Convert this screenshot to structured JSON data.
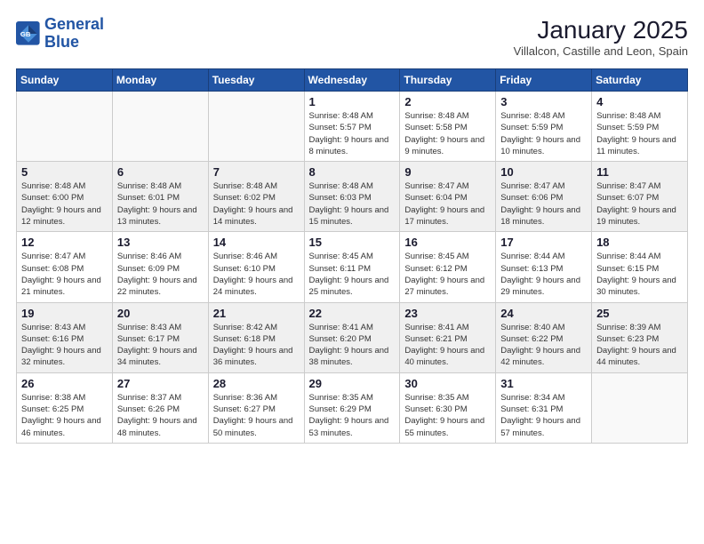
{
  "logo": {
    "line1": "General",
    "line2": "Blue"
  },
  "title": "January 2025",
  "location": "Villalcon, Castille and Leon, Spain",
  "weekdays": [
    "Sunday",
    "Monday",
    "Tuesday",
    "Wednesday",
    "Thursday",
    "Friday",
    "Saturday"
  ],
  "weeks": [
    [
      {
        "day": "",
        "sunrise": "",
        "sunset": "",
        "daylight": ""
      },
      {
        "day": "",
        "sunrise": "",
        "sunset": "",
        "daylight": ""
      },
      {
        "day": "",
        "sunrise": "",
        "sunset": "",
        "daylight": ""
      },
      {
        "day": "1",
        "sunrise": "Sunrise: 8:48 AM",
        "sunset": "Sunset: 5:57 PM",
        "daylight": "Daylight: 9 hours and 8 minutes."
      },
      {
        "day": "2",
        "sunrise": "Sunrise: 8:48 AM",
        "sunset": "Sunset: 5:58 PM",
        "daylight": "Daylight: 9 hours and 9 minutes."
      },
      {
        "day": "3",
        "sunrise": "Sunrise: 8:48 AM",
        "sunset": "Sunset: 5:59 PM",
        "daylight": "Daylight: 9 hours and 10 minutes."
      },
      {
        "day": "4",
        "sunrise": "Sunrise: 8:48 AM",
        "sunset": "Sunset: 5:59 PM",
        "daylight": "Daylight: 9 hours and 11 minutes."
      }
    ],
    [
      {
        "day": "5",
        "sunrise": "Sunrise: 8:48 AM",
        "sunset": "Sunset: 6:00 PM",
        "daylight": "Daylight: 9 hours and 12 minutes."
      },
      {
        "day": "6",
        "sunrise": "Sunrise: 8:48 AM",
        "sunset": "Sunset: 6:01 PM",
        "daylight": "Daylight: 9 hours and 13 minutes."
      },
      {
        "day": "7",
        "sunrise": "Sunrise: 8:48 AM",
        "sunset": "Sunset: 6:02 PM",
        "daylight": "Daylight: 9 hours and 14 minutes."
      },
      {
        "day": "8",
        "sunrise": "Sunrise: 8:48 AM",
        "sunset": "Sunset: 6:03 PM",
        "daylight": "Daylight: 9 hours and 15 minutes."
      },
      {
        "day": "9",
        "sunrise": "Sunrise: 8:47 AM",
        "sunset": "Sunset: 6:04 PM",
        "daylight": "Daylight: 9 hours and 17 minutes."
      },
      {
        "day": "10",
        "sunrise": "Sunrise: 8:47 AM",
        "sunset": "Sunset: 6:06 PM",
        "daylight": "Daylight: 9 hours and 18 minutes."
      },
      {
        "day": "11",
        "sunrise": "Sunrise: 8:47 AM",
        "sunset": "Sunset: 6:07 PM",
        "daylight": "Daylight: 9 hours and 19 minutes."
      }
    ],
    [
      {
        "day": "12",
        "sunrise": "Sunrise: 8:47 AM",
        "sunset": "Sunset: 6:08 PM",
        "daylight": "Daylight: 9 hours and 21 minutes."
      },
      {
        "day": "13",
        "sunrise": "Sunrise: 8:46 AM",
        "sunset": "Sunset: 6:09 PM",
        "daylight": "Daylight: 9 hours and 22 minutes."
      },
      {
        "day": "14",
        "sunrise": "Sunrise: 8:46 AM",
        "sunset": "Sunset: 6:10 PM",
        "daylight": "Daylight: 9 hours and 24 minutes."
      },
      {
        "day": "15",
        "sunrise": "Sunrise: 8:45 AM",
        "sunset": "Sunset: 6:11 PM",
        "daylight": "Daylight: 9 hours and 25 minutes."
      },
      {
        "day": "16",
        "sunrise": "Sunrise: 8:45 AM",
        "sunset": "Sunset: 6:12 PM",
        "daylight": "Daylight: 9 hours and 27 minutes."
      },
      {
        "day": "17",
        "sunrise": "Sunrise: 8:44 AM",
        "sunset": "Sunset: 6:13 PM",
        "daylight": "Daylight: 9 hours and 29 minutes."
      },
      {
        "day": "18",
        "sunrise": "Sunrise: 8:44 AM",
        "sunset": "Sunset: 6:15 PM",
        "daylight": "Daylight: 9 hours and 30 minutes."
      }
    ],
    [
      {
        "day": "19",
        "sunrise": "Sunrise: 8:43 AM",
        "sunset": "Sunset: 6:16 PM",
        "daylight": "Daylight: 9 hours and 32 minutes."
      },
      {
        "day": "20",
        "sunrise": "Sunrise: 8:43 AM",
        "sunset": "Sunset: 6:17 PM",
        "daylight": "Daylight: 9 hours and 34 minutes."
      },
      {
        "day": "21",
        "sunrise": "Sunrise: 8:42 AM",
        "sunset": "Sunset: 6:18 PM",
        "daylight": "Daylight: 9 hours and 36 minutes."
      },
      {
        "day": "22",
        "sunrise": "Sunrise: 8:41 AM",
        "sunset": "Sunset: 6:20 PM",
        "daylight": "Daylight: 9 hours and 38 minutes."
      },
      {
        "day": "23",
        "sunrise": "Sunrise: 8:41 AM",
        "sunset": "Sunset: 6:21 PM",
        "daylight": "Daylight: 9 hours and 40 minutes."
      },
      {
        "day": "24",
        "sunrise": "Sunrise: 8:40 AM",
        "sunset": "Sunset: 6:22 PM",
        "daylight": "Daylight: 9 hours and 42 minutes."
      },
      {
        "day": "25",
        "sunrise": "Sunrise: 8:39 AM",
        "sunset": "Sunset: 6:23 PM",
        "daylight": "Daylight: 9 hours and 44 minutes."
      }
    ],
    [
      {
        "day": "26",
        "sunrise": "Sunrise: 8:38 AM",
        "sunset": "Sunset: 6:25 PM",
        "daylight": "Daylight: 9 hours and 46 minutes."
      },
      {
        "day": "27",
        "sunrise": "Sunrise: 8:37 AM",
        "sunset": "Sunset: 6:26 PM",
        "daylight": "Daylight: 9 hours and 48 minutes."
      },
      {
        "day": "28",
        "sunrise": "Sunrise: 8:36 AM",
        "sunset": "Sunset: 6:27 PM",
        "daylight": "Daylight: 9 hours and 50 minutes."
      },
      {
        "day": "29",
        "sunrise": "Sunrise: 8:35 AM",
        "sunset": "Sunset: 6:29 PM",
        "daylight": "Daylight: 9 hours and 53 minutes."
      },
      {
        "day": "30",
        "sunrise": "Sunrise: 8:35 AM",
        "sunset": "Sunset: 6:30 PM",
        "daylight": "Daylight: 9 hours and 55 minutes."
      },
      {
        "day": "31",
        "sunrise": "Sunrise: 8:34 AM",
        "sunset": "Sunset: 6:31 PM",
        "daylight": "Daylight: 9 hours and 57 minutes."
      },
      {
        "day": "",
        "sunrise": "",
        "sunset": "",
        "daylight": ""
      }
    ]
  ]
}
